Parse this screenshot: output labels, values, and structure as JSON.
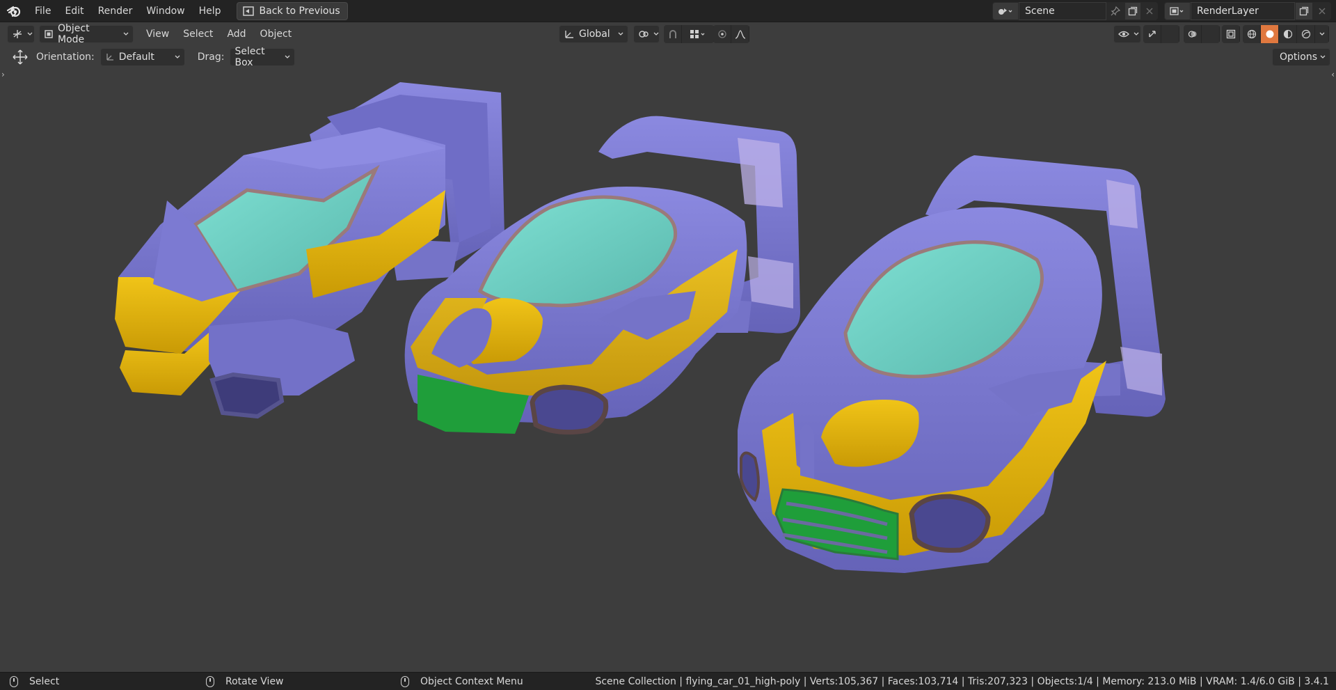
{
  "menubar": {
    "items": [
      "File",
      "Edit",
      "Render",
      "Window",
      "Help"
    ],
    "back_button": "Back to Previous",
    "scene_name": "Scene",
    "render_layer": "RenderLayer"
  },
  "header": {
    "mode": "Object Mode",
    "menus": [
      "View",
      "Select",
      "Add",
      "Object"
    ],
    "transform_orientation": "Global"
  },
  "tool_settings": {
    "orientation_label": "Orientation:",
    "orientation_value": "Default",
    "drag_label": "Drag:",
    "drag_value": "Select Box",
    "options_label": "Options"
  },
  "status_bar": {
    "hints": [
      {
        "icon": "mouse-left-icon",
        "label": "Select"
      },
      {
        "icon": "mouse-middle-icon",
        "label": "Rotate View"
      },
      {
        "icon": "mouse-right-icon",
        "label": "Object Context Menu"
      }
    ],
    "info": "Scene Collection | flying_car_01_high-poly | Verts:105,367 | Faces:103,714 | Tris:207,323 | Objects:1/4 | Memory: 213.0 MiB | VRAM: 1.4/6.0 GiB | 3.4.1"
  },
  "colors": {
    "body_purple": "#7a78d0",
    "accent_yellow": "#e2b80f",
    "glass_teal": "#6fcfc3",
    "grille_green": "#1f9e3a",
    "viewport_bg": "#3d3d3d"
  }
}
